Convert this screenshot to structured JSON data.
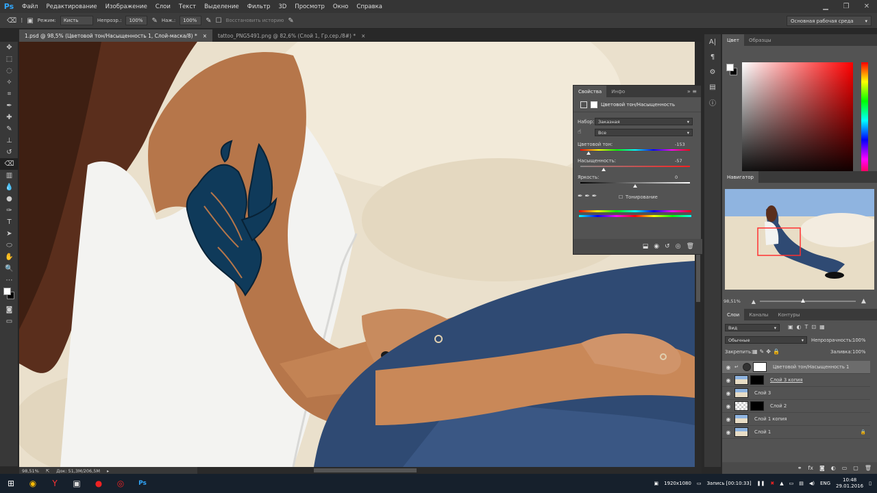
{
  "app": {
    "logo": "Ps"
  },
  "menu": [
    "Файл",
    "Редактирование",
    "Изображение",
    "Слои",
    "Текст",
    "Выделение",
    "Фильтр",
    "3D",
    "Просмотр",
    "Окно",
    "Справка"
  ],
  "options": {
    "mode_label": "Режим:",
    "mode_value": "Кисть",
    "opacity_label": "Непрозр.:",
    "opacity_value": "100%",
    "pressure_label": "Наж.:",
    "pressure_value": "100%",
    "history_label": "Восстановить историю",
    "workspace": "Основная рабочая среда"
  },
  "tabs": [
    {
      "label": "1.psd @ 98,5% (Цветовой тон/Насыщенность 1, Слой-маска/8) *",
      "close": "×"
    },
    {
      "label": "tattoo_PNG5491.png @ 82,6% (Слой 1, Гр.сер./8#) *",
      "close": "×"
    }
  ],
  "status": {
    "zoom": "98,51%",
    "doc": "Док: 51,3M/206,5M"
  },
  "properties": {
    "tab_active": "Свойства",
    "tab_other": "Инфо",
    "title": "Цветовой тон/Насыщенность",
    "preset_label": "Набор:",
    "preset_value": "Заказная",
    "channel_value": "Все",
    "hue_label": "Цветовой тон:",
    "hue_value": "-153",
    "hue_fraction": 0.075,
    "sat_label": "Насыщенность:",
    "sat_value": "-57",
    "sat_fraction": 0.215,
    "light_label": "Яркость:",
    "light_value": "0",
    "light_fraction": 0.5,
    "colorize_label": "Тонирование"
  },
  "color_panel": {
    "tab_active": "Цвет",
    "tab_other": "Образцы",
    "fg": "#ffffff",
    "bg": "#000000",
    "hue": "#ff0000"
  },
  "navigator": {
    "title": "Навигатор",
    "zoom": "98,51%",
    "zoom_fraction": 0.45
  },
  "layers": {
    "tab_active": "Слои",
    "tab_channels": "Каналы",
    "tab_paths": "Контуры",
    "filter_value": "Вид",
    "blend_value": "Обычные",
    "opacity_label": "Непрозрачность:",
    "opacity_value": "100%",
    "lock_label": "Закрепить:",
    "fill_label": "Заливка:",
    "fill_value": "100%",
    "items": [
      {
        "name": "Цветовой тон/Насыщенность 1",
        "type": "adjustment",
        "selected": true
      },
      {
        "name": "Слой 3 копия",
        "type": "masked",
        "selected": false
      },
      {
        "name": "Слой 3",
        "type": "photo",
        "selected": false
      },
      {
        "name": "Слой 2",
        "type": "transparent-masked",
        "selected": false
      },
      {
        "name": "Слой 1 копия",
        "type": "photo",
        "selected": false
      },
      {
        "name": "Слой 1",
        "type": "photo-locked",
        "selected": false
      }
    ]
  },
  "taskbar": {
    "resolution": "1920x1080",
    "recording": "Запись [00:10:33]",
    "lang": "ENG",
    "time": "10:48",
    "date": "29.01.2016"
  }
}
